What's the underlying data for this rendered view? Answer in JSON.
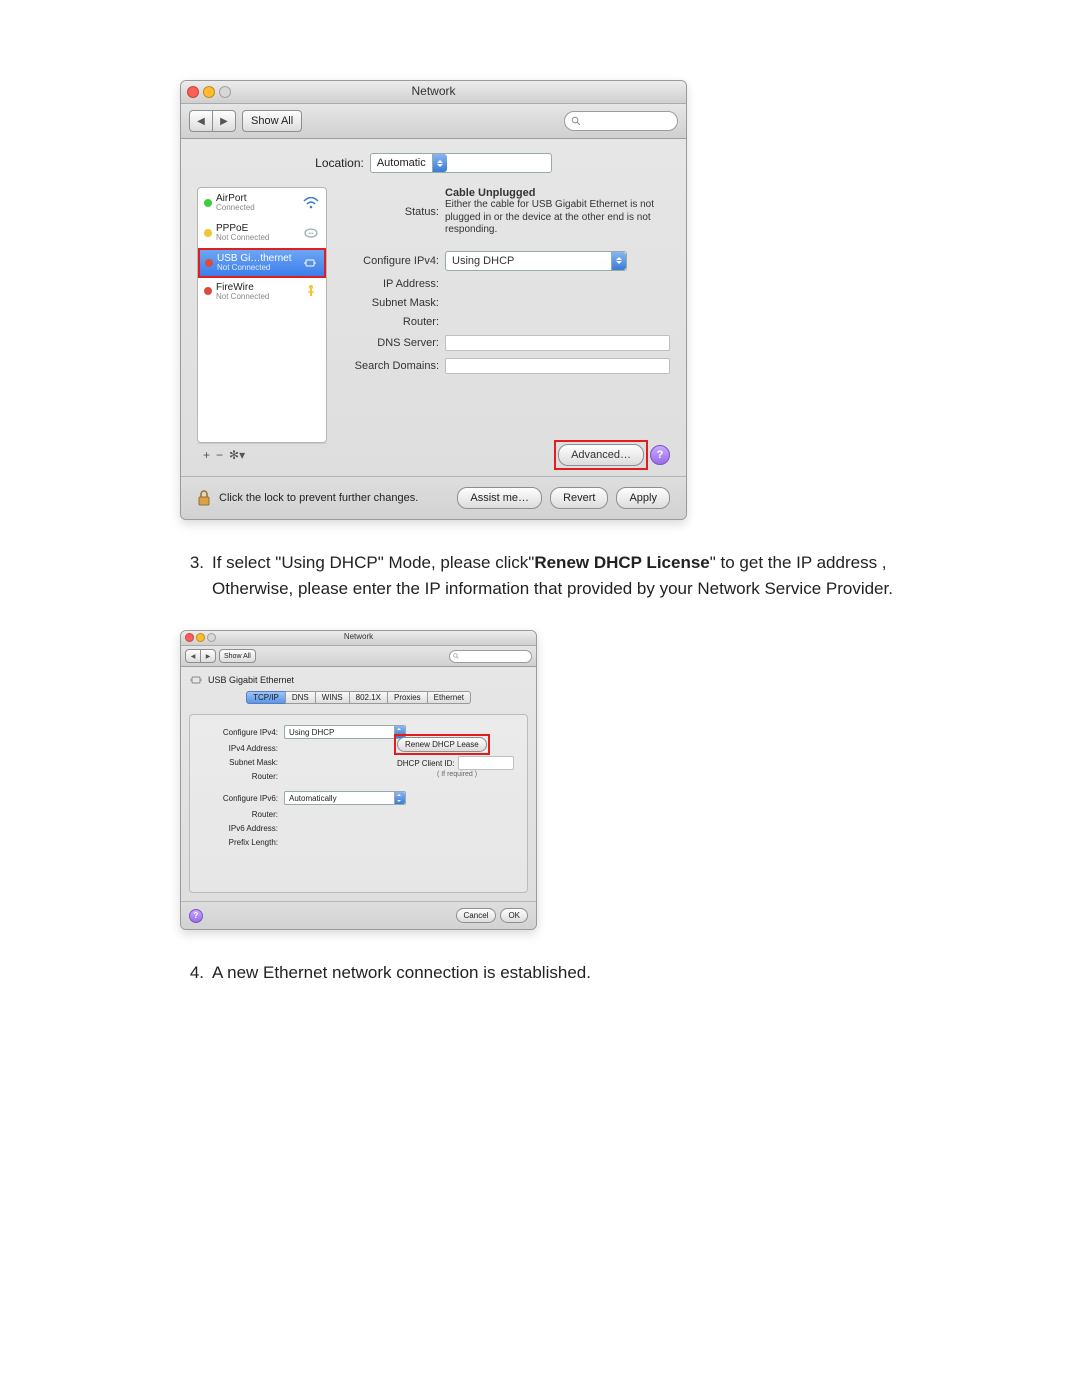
{
  "doc": {
    "item3_num": "3.",
    "item3_a": "If select \"Using DHCP\" Mode, please click\"",
    "item3_b": "Renew DHCP License",
    "item3_c": "\" to get the IP address , Otherwise, please enter the IP information that provided by your Network Service Provider.",
    "item4_num": "4.",
    "item4": "A new Ethernet network connection is established."
  },
  "w1": {
    "title": "Network",
    "showall": "Show All",
    "loc_label": "Location:",
    "loc_value": "Automatic",
    "sidebar": [
      {
        "name": "AirPort",
        "sub": "Connected",
        "dot": "d-g",
        "icon": "wifi"
      },
      {
        "name": "PPPoE",
        "sub": "Not Connected",
        "dot": "d-y",
        "icon": "phone"
      },
      {
        "name": "USB Gi…thernet",
        "sub": "Not Connected",
        "dot": "d-r",
        "icon": "eth",
        "sel": true,
        "hl": true
      },
      {
        "name": "FireWire",
        "sub": "Not Connected",
        "dot": "d-r",
        "icon": "fw"
      }
    ],
    "plus": "+",
    "minus": "−",
    "gear": "✻▾",
    "status_lbl": "Status:",
    "status_val": "Cable Unplugged",
    "status_note": "Either the cable for USB Gigabit Ethernet is not plugged in or the device at the other end is not responding.",
    "cfg_lbl": "Configure IPv4:",
    "cfg_val": "Using DHCP",
    "ip_lbl": "IP Address:",
    "mask_lbl": "Subnet Mask:",
    "router_lbl": "Router:",
    "dns_lbl": "DNS Server:",
    "sd_lbl": "Search Domains:",
    "advanced": "Advanced…",
    "lock_text": "Click the lock to prevent further changes.",
    "assist": "Assist me…",
    "revert": "Revert",
    "apply": "Apply"
  },
  "w2": {
    "title": "Network",
    "showall": "Show All",
    "chip": "USB Gigabit Ethernet",
    "tabs": [
      "TCP/IP",
      "DNS",
      "WINS",
      "802.1X",
      "Proxies",
      "Ethernet"
    ],
    "active_tab": 0,
    "cfg4_lbl": "Configure IPv4:",
    "cfg4_val": "Using DHCP",
    "ip4_lbl": "IPv4 Address:",
    "mask_lbl": "Subnet Mask:",
    "router_lbl": "Router:",
    "renew": "Renew DHCP Lease",
    "cli_lbl": "DHCP Client ID:",
    "req": "( If required )",
    "cfg6_lbl": "Configure IPv6:",
    "cfg6_val": "Automatically",
    "router6_lbl": "Router:",
    "ip6_lbl": "IPv6 Address:",
    "plen_lbl": "Prefix Length:",
    "cancel": "Cancel",
    "ok": "OK"
  }
}
